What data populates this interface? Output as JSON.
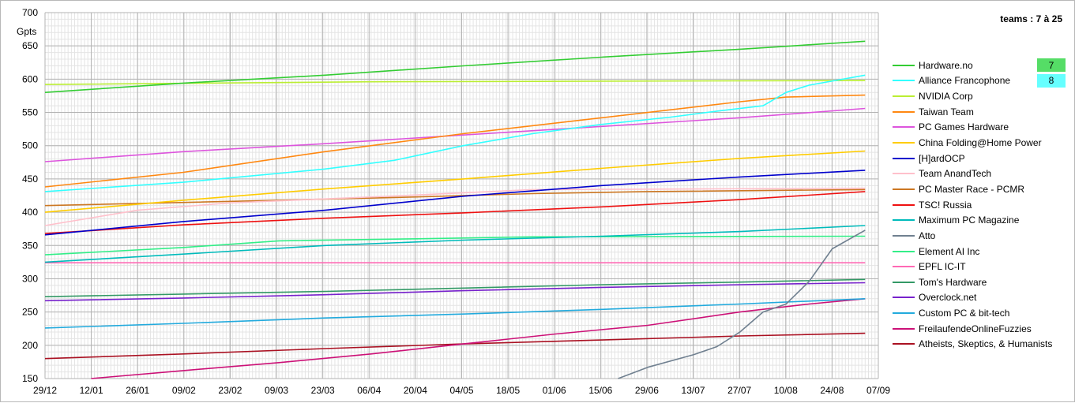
{
  "title": "teams : 7 à 25",
  "chart_data": {
    "type": "line",
    "ylabel": "Gpts",
    "ylim": [
      150,
      700
    ],
    "yticks": [
      150,
      200,
      250,
      300,
      350,
      400,
      450,
      500,
      550,
      600,
      650,
      700
    ],
    "xlim": [
      "2019-12-29",
      "2020-09-07"
    ],
    "xtick_labels": [
      "29/12",
      "12/01",
      "26/01",
      "09/02",
      "23/02",
      "09/03",
      "23/03",
      "06/04",
      "20/04",
      "04/05",
      "18/05",
      "01/06",
      "15/06",
      "29/06",
      "13/07",
      "27/07",
      "10/08",
      "24/08",
      "07/09"
    ],
    "grid": true,
    "legend_position": "right",
    "series": [
      {
        "name": "Hardware.no",
        "color": "#33cc33",
        "rank": "7",
        "points": [
          [
            "2019-12-29",
            580
          ],
          [
            "2020-02-09",
            594
          ],
          [
            "2020-03-23",
            606
          ],
          [
            "2020-05-04",
            620
          ],
          [
            "2020-06-15",
            633
          ],
          [
            "2020-07-27",
            645
          ],
          [
            "2020-09-03",
            657
          ]
        ]
      },
      {
        "name": "Alliance Francophone",
        "color": "#33ffff",
        "rank": "8",
        "points": [
          [
            "2019-12-29",
            431
          ],
          [
            "2020-02-09",
            445
          ],
          [
            "2020-03-23",
            465
          ],
          [
            "2020-04-13",
            478
          ],
          [
            "2020-05-04",
            500
          ],
          [
            "2020-05-25",
            518
          ],
          [
            "2020-06-15",
            532
          ],
          [
            "2020-07-06",
            543
          ],
          [
            "2020-07-20",
            552
          ],
          [
            "2020-08-03",
            560
          ],
          [
            "2020-08-10",
            580
          ],
          [
            "2020-08-17",
            591
          ],
          [
            "2020-09-03",
            606
          ]
        ]
      },
      {
        "name": "NVIDIA Corp",
        "color": "#bbee33",
        "points": [
          [
            "2019-12-29",
            592
          ],
          [
            "2020-04-06",
            596
          ],
          [
            "2020-09-03",
            598
          ]
        ]
      },
      {
        "name": "Taiwan Team",
        "color": "#ff8811",
        "points": [
          [
            "2019-12-29",
            438
          ],
          [
            "2020-02-09",
            460
          ],
          [
            "2020-03-23",
            491
          ],
          [
            "2020-05-04",
            518
          ],
          [
            "2020-06-15",
            542
          ],
          [
            "2020-07-27",
            566
          ],
          [
            "2020-08-10",
            573
          ],
          [
            "2020-09-03",
            576
          ]
        ]
      },
      {
        "name": "PC Games Hardware",
        "color": "#dd55dd",
        "points": [
          [
            "2019-12-29",
            476
          ],
          [
            "2020-02-09",
            491
          ],
          [
            "2020-03-23",
            503
          ],
          [
            "2020-05-04",
            516
          ],
          [
            "2020-06-15",
            529
          ],
          [
            "2020-07-27",
            542
          ],
          [
            "2020-09-03",
            556
          ]
        ]
      },
      {
        "name": "China Folding@Home Power",
        "color": "#ffcc00",
        "points": [
          [
            "2019-12-29",
            400
          ],
          [
            "2020-02-09",
            418
          ],
          [
            "2020-03-23",
            435
          ],
          [
            "2020-05-04",
            450
          ],
          [
            "2020-06-15",
            466
          ],
          [
            "2020-07-27",
            481
          ],
          [
            "2020-09-03",
            492
          ]
        ]
      },
      {
        "name": "[H]ardOCP",
        "color": "#0000cc",
        "points": [
          [
            "2019-12-29",
            366
          ],
          [
            "2020-02-09",
            386
          ],
          [
            "2020-03-23",
            403
          ],
          [
            "2020-05-04",
            424
          ],
          [
            "2020-06-15",
            440
          ],
          [
            "2020-07-27",
            453
          ],
          [
            "2020-09-03",
            463
          ]
        ]
      },
      {
        "name": "Team AnandTech",
        "color": "#ffc0cb",
        "points": [
          [
            "2019-12-29",
            380
          ],
          [
            "2020-01-26",
            403
          ],
          [
            "2020-02-23",
            414
          ],
          [
            "2020-03-23",
            420
          ],
          [
            "2020-04-20",
            426
          ],
          [
            "2020-05-25",
            434
          ],
          [
            "2020-09-03",
            436
          ]
        ]
      },
      {
        "name": "PC Master Race - PCMR",
        "color": "#cc7722",
        "points": [
          [
            "2019-12-29",
            410
          ],
          [
            "2020-03-09",
            418
          ],
          [
            "2020-04-20",
            423
          ],
          [
            "2020-05-25",
            428
          ],
          [
            "2020-06-29",
            431
          ],
          [
            "2020-09-03",
            434
          ]
        ]
      },
      {
        "name": "TSC! Russia",
        "color": "#ee1111",
        "points": [
          [
            "2019-12-29",
            368
          ],
          [
            "2020-02-09",
            381
          ],
          [
            "2020-03-23",
            391
          ],
          [
            "2020-05-04",
            399
          ],
          [
            "2020-06-15",
            408
          ],
          [
            "2020-07-27",
            419
          ],
          [
            "2020-09-03",
            431
          ]
        ]
      },
      {
        "name": "Maximum PC Magazine",
        "color": "#00bbbb",
        "points": [
          [
            "2019-12-29",
            325
          ],
          [
            "2020-02-09",
            337
          ],
          [
            "2020-03-23",
            350
          ],
          [
            "2020-05-04",
            358
          ],
          [
            "2020-06-15",
            364
          ],
          [
            "2020-07-27",
            371
          ],
          [
            "2020-09-03",
            380
          ]
        ]
      },
      {
        "name": "Atto",
        "color": "#708090",
        "points": [
          [
            "2020-06-20",
            150
          ],
          [
            "2020-06-29",
            167
          ],
          [
            "2020-07-13",
            186
          ],
          [
            "2020-07-20",
            198
          ],
          [
            "2020-07-27",
            220
          ],
          [
            "2020-08-03",
            250
          ],
          [
            "2020-08-10",
            262
          ],
          [
            "2020-08-17",
            296
          ],
          [
            "2020-08-24",
            345
          ],
          [
            "2020-09-03",
            373
          ]
        ]
      },
      {
        "name": "Element AI Inc",
        "color": "#33ee88",
        "points": [
          [
            "2019-12-29",
            336
          ],
          [
            "2020-02-09",
            347
          ],
          [
            "2020-03-09",
            357
          ],
          [
            "2020-04-20",
            360
          ],
          [
            "2020-05-25",
            363
          ],
          [
            "2020-09-03",
            364
          ]
        ]
      },
      {
        "name": "EPFL IC-IT",
        "color": "#ff69b4",
        "points": [
          [
            "2019-12-29",
            324
          ],
          [
            "2020-09-03",
            324
          ]
        ]
      },
      {
        "name": "Tom's Hardware",
        "color": "#339966",
        "points": [
          [
            "2019-12-29",
            273
          ],
          [
            "2020-02-09",
            277
          ],
          [
            "2020-03-23",
            281
          ],
          [
            "2020-05-04",
            286
          ],
          [
            "2020-06-15",
            291
          ],
          [
            "2020-07-27",
            295
          ],
          [
            "2020-09-03",
            299
          ]
        ]
      },
      {
        "name": "Overclock.net",
        "color": "#7722cc",
        "points": [
          [
            "2019-12-29",
            267
          ],
          [
            "2020-02-09",
            271
          ],
          [
            "2020-03-23",
            276
          ],
          [
            "2020-05-04",
            282
          ],
          [
            "2020-06-15",
            287
          ],
          [
            "2020-07-27",
            291
          ],
          [
            "2020-09-03",
            294
          ]
        ]
      },
      {
        "name": "Custom PC & bit-tech",
        "color": "#22aadd",
        "points": [
          [
            "2019-12-29",
            226
          ],
          [
            "2020-02-09",
            233
          ],
          [
            "2020-03-23",
            241
          ],
          [
            "2020-05-04",
            247
          ],
          [
            "2020-06-15",
            254
          ],
          [
            "2020-07-27",
            262
          ],
          [
            "2020-09-03",
            270
          ]
        ]
      },
      {
        "name": "FreilaufendeOnlineFuzzies",
        "color": "#cc1177",
        "points": [
          [
            "2020-01-12",
            150
          ],
          [
            "2020-02-09",
            162
          ],
          [
            "2020-03-09",
            174
          ],
          [
            "2020-04-06",
            187
          ],
          [
            "2020-05-04",
            202
          ],
          [
            "2020-06-01",
            217
          ],
          [
            "2020-06-29",
            230
          ],
          [
            "2020-07-27",
            250
          ],
          [
            "2020-08-17",
            262
          ],
          [
            "2020-09-03",
            270
          ]
        ]
      },
      {
        "name": "Atheists, Skeptics, & Humanists",
        "color": "#aa1122",
        "points": [
          [
            "2019-12-29",
            180
          ],
          [
            "2020-02-09",
            187
          ],
          [
            "2020-03-23",
            195
          ],
          [
            "2020-05-04",
            202
          ],
          [
            "2020-06-15",
            208
          ],
          [
            "2020-07-27",
            214
          ],
          [
            "2020-09-03",
            218
          ]
        ]
      }
    ]
  }
}
